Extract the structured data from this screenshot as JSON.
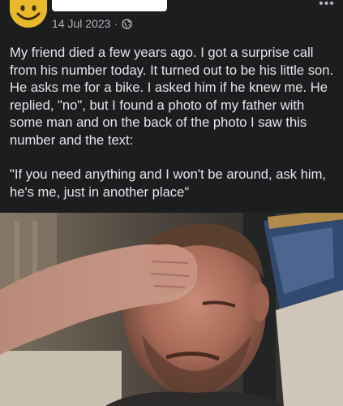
{
  "post": {
    "author_avatar": "smiley-face-avatar",
    "date": "14 Jul 2023",
    "separator": "·",
    "privacy_icon": "globe-icon",
    "more_icon": "more-options-icon",
    "more_label": "•••",
    "paragraphs": [
      "My friend died a few years ago. I got a surprise call from his number today. It turned out to be his little son. He asks me for a bike. I asked him if he knew me. He replied, \"no\", but I found a photo of my father with some man and on the back of the photo I saw this number and the text:",
      "\"If you need anything and I won't be around, ask him, he's me, just in another place\""
    ],
    "image": "crying-man-saluting-photo"
  },
  "colors": {
    "background": "#1c1d1f",
    "text": "#e4e6eb",
    "secondary_text": "#b0b3b8",
    "avatar": "#e9b92c"
  }
}
